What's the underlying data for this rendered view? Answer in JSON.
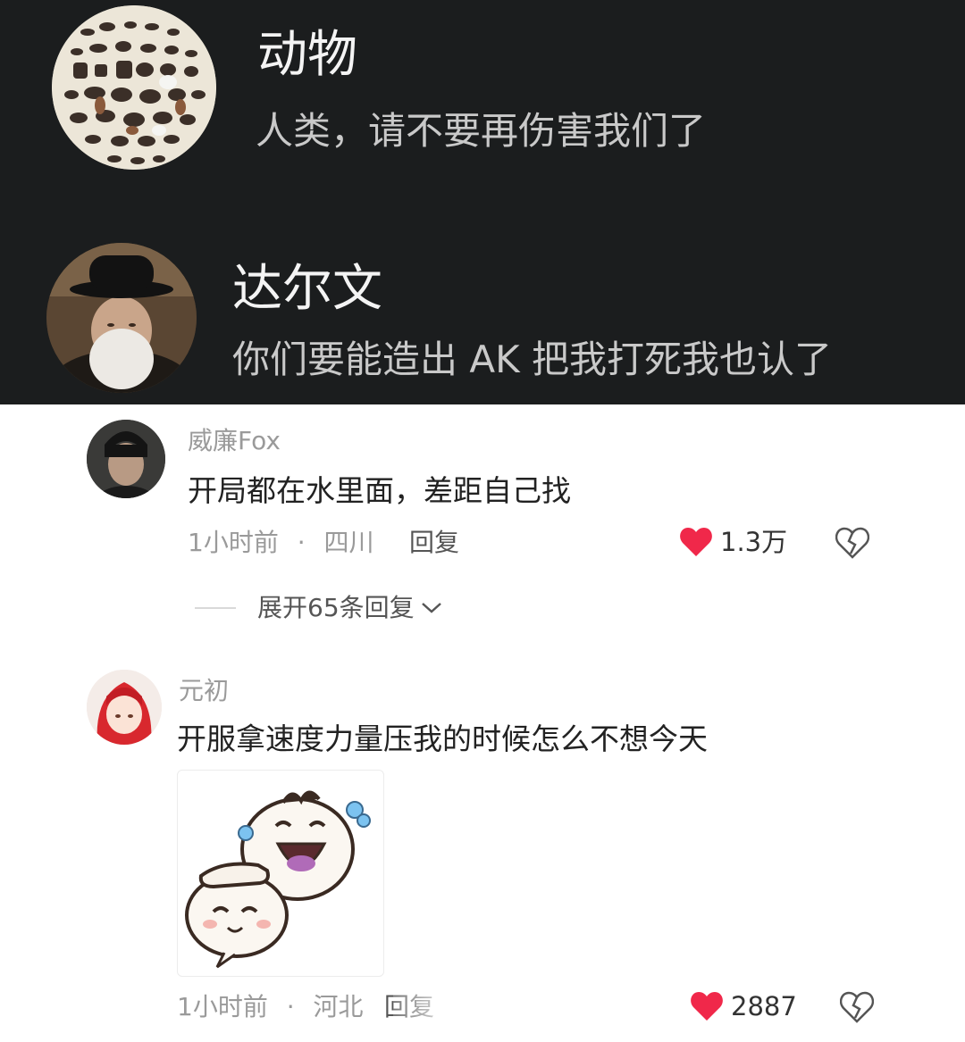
{
  "post": {
    "animals": {
      "avatar_icon": "animals-collage-avatar",
      "name": "动物",
      "text": "人类，请不要再伤害我们了"
    },
    "darwin": {
      "avatar_icon": "darwin-portrait-avatar",
      "name": "达尔文",
      "text": "你们要能造出 AK 把我打死我也认了"
    }
  },
  "comments": [
    {
      "username": "威廉Fox",
      "text": "开局都在水里面，差距自己找",
      "time": "1小时前",
      "location": "四川",
      "reply_label": "回复",
      "likes": "1.3万",
      "expand_label": "展开65条回复"
    },
    {
      "username": "元初",
      "text": "开服拿速度力量压我的时候怎么不想今天",
      "time": "1小时前",
      "location": "河北",
      "reply_label": "回复",
      "likes": "2887",
      "sticker_icon": "crying-laughing-bun-sticker"
    }
  ],
  "colors": {
    "like_heart": "#f0284a",
    "dark_background": "#1b1d1e"
  }
}
